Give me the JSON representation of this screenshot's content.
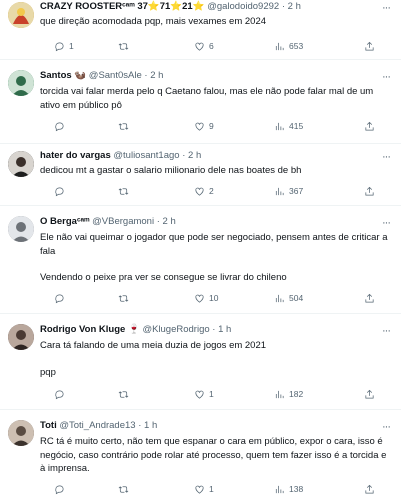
{
  "tweets": [
    {
      "name": "CRAZY ROOSTERᶜᵃᵐ 37⭐️71⭐️21⭐️",
      "handle": "@galodoido9292",
      "time": "2 h",
      "lines": [
        "que direção acomodada pqp, mais vexames em 2024"
      ],
      "replies": "1",
      "retweets": "",
      "likes": "6",
      "views": "653",
      "avatar_color": "#c9a03a"
    },
    {
      "name": "Santos 🦦",
      "handle": "@Sant0sAle",
      "time": "2 h",
      "lines": [
        "torcida vai falar merda pelo q Caetano falou, mas ele não pode falar mal de um ativo em público pô"
      ],
      "replies": "",
      "retweets": "",
      "likes": "9",
      "views": "415",
      "avatar_color": "#3c7d5a"
    },
    {
      "name": "hater do vargas",
      "handle": "@tuliosant1ago",
      "time": "2 h",
      "lines": [
        "dedicou mt a gastar o salario milionario dele nas boates de bh"
      ],
      "replies": "",
      "retweets": "",
      "likes": "2",
      "views": "367",
      "avatar_color": "#3a3a3a"
    },
    {
      "name": "O Bergaᶜᵃᵐ",
      "handle": "@VBergamoni",
      "time": "2 h",
      "lines": [
        "Ele não vai queimar o jogador que pode ser negociado, pensem antes de criticar a fala",
        "Vendendo o peixe pra ver se consegue se livrar do chileno"
      ],
      "replies": "",
      "retweets": "",
      "likes": "10",
      "views": "504",
      "avatar_color": "#8a8f96"
    },
    {
      "name": "Rodrigo Von Kluge 🍷",
      "handle": "@KlugeRodrigo",
      "time": "1 h",
      "lines": [
        "Cara tá falando de uma meia duzia de jogos em 2021",
        "pqp"
      ],
      "replies": "",
      "retweets": "",
      "likes": "1",
      "views": "182",
      "avatar_color": "#5b4a44"
    },
    {
      "name": "Toti",
      "handle": "@Toti_Andrade13",
      "time": "1 h",
      "lines": [
        "RC tá é muito certo, não tem que espanar o cara em público, expor o cara, isso é negócio, caso contrário pode rolar até processo, quem tem fazer isso é a torcida e à imprensa."
      ],
      "replies": "",
      "retweets": "",
      "likes": "1",
      "views": "138",
      "avatar_color": "#6e6258"
    }
  ],
  "icons": {
    "reply": "reply-icon",
    "retweet": "retweet-icon",
    "like": "heart-icon",
    "views": "views-icon",
    "share": "share-icon",
    "more": "more-icon"
  }
}
